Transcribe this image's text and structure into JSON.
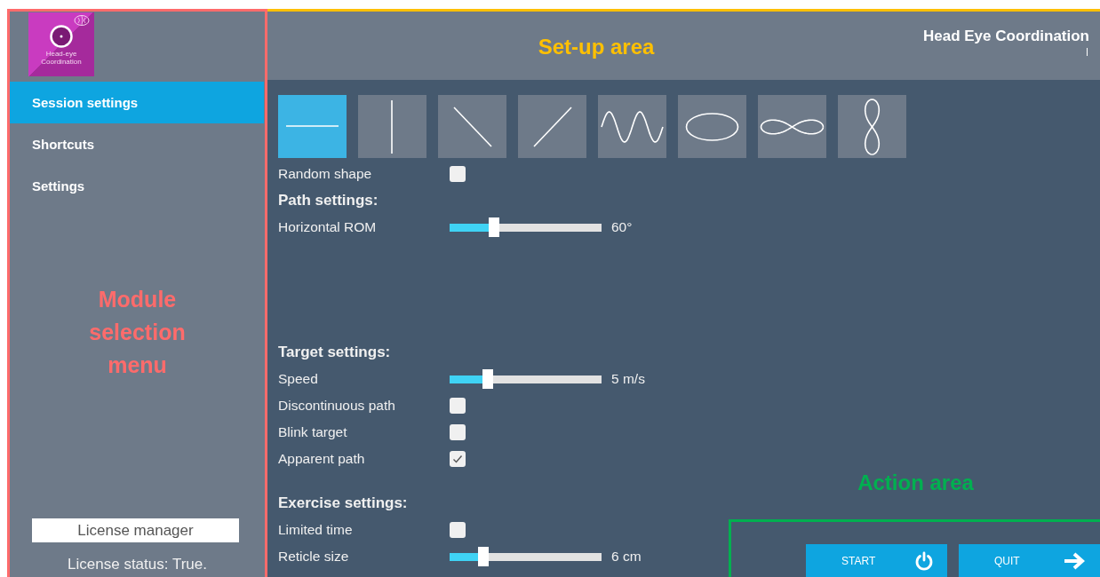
{
  "sidebar": {
    "logo_caption": [
      "Head-eye",
      "Coordination"
    ],
    "items": [
      {
        "label": "Session settings",
        "selected": true
      },
      {
        "label": "Shortcuts",
        "selected": false
      },
      {
        "label": "Settings",
        "selected": false
      }
    ],
    "license_button": "License manager",
    "license_status": "License status: True."
  },
  "header": {
    "title": "Head Eye Coordination"
  },
  "shapes": [
    {
      "kind": "horizontal",
      "selected": true
    },
    {
      "kind": "vertical",
      "selected": false
    },
    {
      "kind": "diagonal-down",
      "selected": false
    },
    {
      "kind": "diagonal-up",
      "selected": false
    },
    {
      "kind": "sine",
      "selected": false
    },
    {
      "kind": "ellipse",
      "selected": false
    },
    {
      "kind": "infinity",
      "selected": false
    },
    {
      "kind": "figure-eight",
      "selected": false
    }
  ],
  "random_shape": {
    "label": "Random shape",
    "checked": false
  },
  "sections": [
    {
      "heading": "Path settings:",
      "rows": [
        {
          "kind": "slider",
          "label": "Horizontal ROM",
          "level": 0.29,
          "reading": "60°"
        }
      ]
    },
    {
      "heading": "Target settings:",
      "rows": [
        {
          "kind": "slider",
          "label": "Speed",
          "level": 0.25,
          "reading": "5 m/s"
        },
        {
          "kind": "checkbox",
          "label": "Discontinuous path",
          "checked": false
        },
        {
          "kind": "checkbox",
          "label": "Blink target",
          "checked": false
        },
        {
          "kind": "checkbox",
          "label": "Apparent path",
          "checked": true
        }
      ]
    },
    {
      "heading": "Exercise settings:",
      "rows": [
        {
          "kind": "checkbox",
          "label": "Limited time",
          "checked": false
        },
        {
          "kind": "slider",
          "label": "Reticle size",
          "level": 0.22,
          "reading": "6 cm"
        }
      ]
    }
  ],
  "actions": [
    {
      "kind": "power",
      "label": "START"
    },
    {
      "kind": "arrow",
      "label": "QUIT"
    }
  ],
  "annotations": [
    {
      "kind": "sidebar",
      "text": "Module selection menu",
      "color": "#ff6b6b"
    },
    {
      "kind": "setup",
      "text": "Set-up area",
      "color": "#ffc000"
    },
    {
      "kind": "action",
      "text": "Action area",
      "color": "#00b050"
    }
  ]
}
